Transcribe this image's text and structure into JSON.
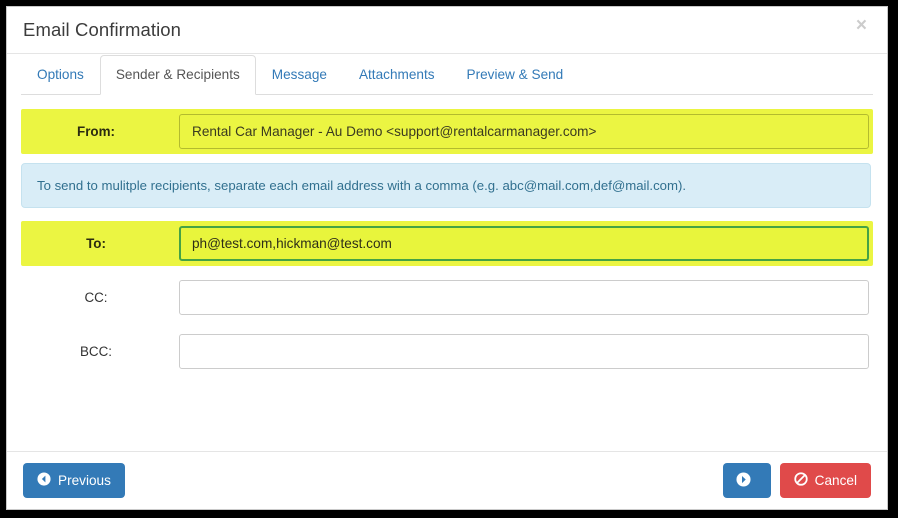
{
  "dialog": {
    "title": "Email Confirmation",
    "close_label": "×"
  },
  "tabs": [
    {
      "label": "Options",
      "active": false
    },
    {
      "label": "Sender & Recipients",
      "active": true
    },
    {
      "label": "Message",
      "active": false
    },
    {
      "label": "Attachments",
      "active": false
    },
    {
      "label": "Preview & Send",
      "active": false
    }
  ],
  "form": {
    "from": {
      "label": "From:",
      "value": "Rental Car Manager - Au Demo <support@rentalcarmanager.com>",
      "placeholder": "",
      "highlighted": true
    },
    "to": {
      "label": "To:",
      "value": "ph@test.com,hickman@test.com",
      "placeholder": "",
      "highlighted": true,
      "focused": true
    },
    "cc": {
      "label": "CC:",
      "value": "",
      "placeholder": "",
      "highlighted": false
    },
    "bcc": {
      "label": "BCC:",
      "value": "",
      "placeholder": "",
      "highlighted": false
    }
  },
  "info_banner": {
    "text": "To send to mulitple recipients, separate each email address with a comma (e.g. abc@mail.com,def@mail.com)."
  },
  "footer": {
    "previous_label": "Previous",
    "next_label": "",
    "cancel_label": "Cancel",
    "previous_icon": "arrow-circle-left-icon",
    "next_icon": "arrow-circle-right-icon",
    "cancel_icon": "ban-icon"
  },
  "colors": {
    "highlight_yellow": "#ebf542",
    "focus_green": "#45a245",
    "info_blue_bg": "#d9edf7",
    "info_blue_text": "#31708f",
    "primary_blue": "#337ab7",
    "danger_red": "#e04a4a",
    "tab_link": "#337ab7"
  }
}
